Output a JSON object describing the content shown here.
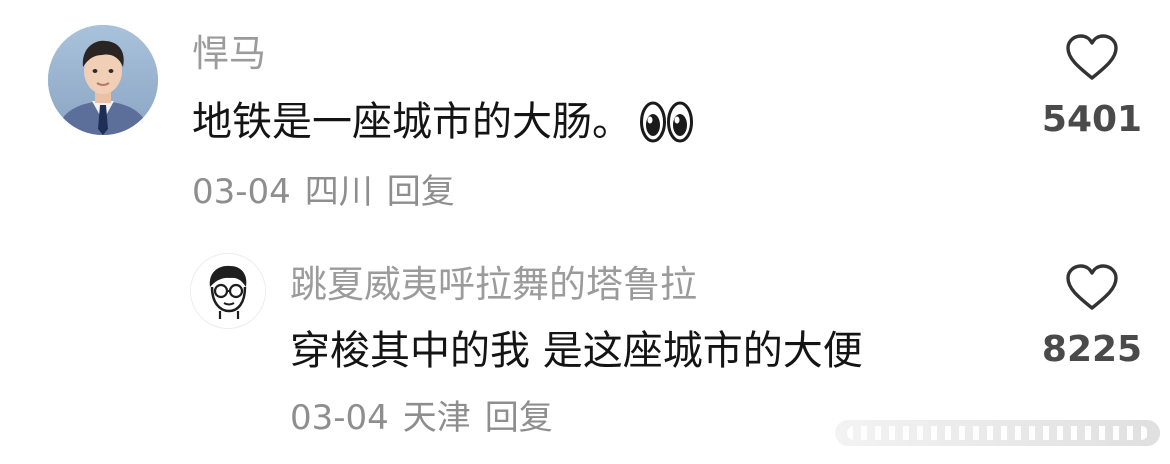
{
  "comments": [
    {
      "username": "悍马",
      "text": "地铁是一座城市的大肠。",
      "emoji": "eyes-emoji",
      "date": "03-04",
      "location": "四川",
      "reply_label": "回复",
      "likes": "5401"
    },
    {
      "username": "跳夏威夷呼拉舞的塔鲁拉",
      "text": "穿梭其中的我 是这座城市的大便",
      "date": "03-04",
      "location": "天津",
      "reply_label": "回复",
      "likes": "8225"
    }
  ],
  "icons": {
    "like": "heart-outline-icon"
  },
  "colors": {
    "username": "#9b9b9b",
    "text": "#141414",
    "meta": "#8e8e8e",
    "like_count": "#4a4a4a"
  }
}
